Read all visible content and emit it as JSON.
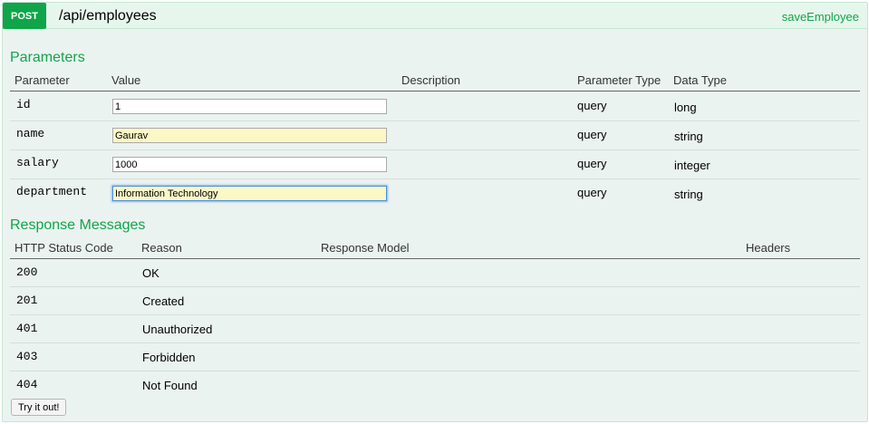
{
  "operation": {
    "method": "POST",
    "path": "/api/employees",
    "nickname": "saveEmployee"
  },
  "parameters": {
    "title": "Parameters",
    "headers": {
      "parameter": "Parameter",
      "value": "Value",
      "description": "Description",
      "param_type": "Parameter Type",
      "data_type": "Data Type"
    },
    "rows": [
      {
        "name": "id",
        "value": "1",
        "description": "",
        "param_type": "query",
        "data_type": "long"
      },
      {
        "name": "name",
        "value": "Gaurav",
        "description": "",
        "param_type": "query",
        "data_type": "string"
      },
      {
        "name": "salary",
        "value": "1000",
        "description": "",
        "param_type": "query",
        "data_type": "integer"
      },
      {
        "name": "department",
        "value": "Information Technology",
        "description": "",
        "param_type": "query",
        "data_type": "string"
      }
    ]
  },
  "responses": {
    "title": "Response Messages",
    "headers": {
      "status": "HTTP Status Code",
      "reason": "Reason",
      "model": "Response Model",
      "headers": "Headers"
    },
    "rows": [
      {
        "status": "200",
        "reason": "OK"
      },
      {
        "status": "201",
        "reason": "Created"
      },
      {
        "status": "401",
        "reason": "Unauthorized"
      },
      {
        "status": "403",
        "reason": "Forbidden"
      },
      {
        "status": "404",
        "reason": "Not Found"
      }
    ]
  },
  "try_button": {
    "label": "Try it out!"
  },
  "colors": {
    "method_post": "#10a54a",
    "heading_bg": "#e7f6ec",
    "panel_bg": "#ebf3f0",
    "required_field_bg": "#fcf8c6",
    "accent_text": "#10a54a"
  }
}
